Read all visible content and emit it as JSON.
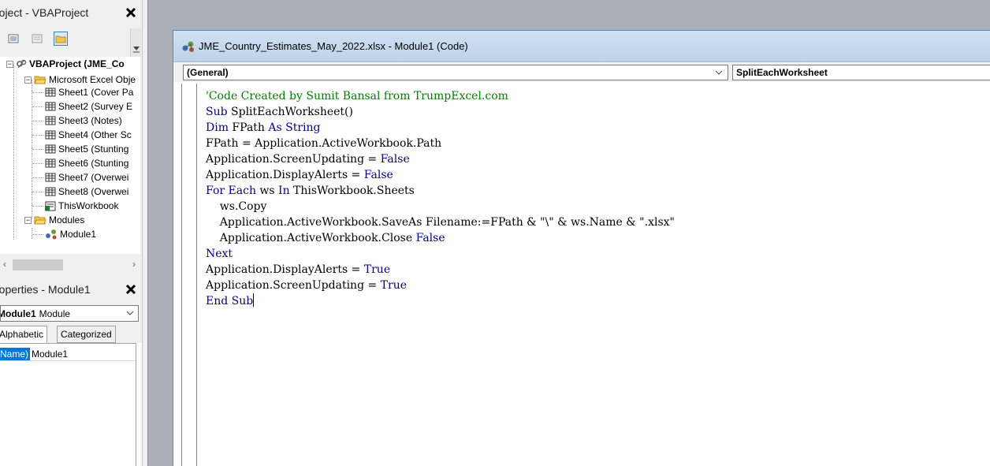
{
  "project_pane": {
    "title": "roject - VBAProject",
    "tree": {
      "root_label": "VBAProject (JME_Co",
      "folders": [
        {
          "label": "Microsoft Excel Obje",
          "items": [
            "Sheet1 (Cover Pa",
            "Sheet2 (Survey E",
            "Sheet3 (Notes)",
            "Sheet4 (Other Sc",
            "Sheet5 (Stunting",
            "Sheet6 (Stunting",
            "Sheet7 (Overwei",
            "Sheet8 (Overwei",
            "ThisWorkbook"
          ]
        },
        {
          "label": "Modules",
          "items": [
            "Module1"
          ]
        }
      ]
    }
  },
  "properties_pane": {
    "title": "roperties - Module1",
    "object_name": "Module1",
    "object_type": "Module",
    "tabs": [
      "Alphabetic",
      "Categorized"
    ],
    "rows": [
      {
        "name": "(Name)",
        "value": "Module1"
      }
    ]
  },
  "code_window": {
    "title": "JME_Country_Estimates_May_2022.xlsx - Module1 (Code)",
    "object_combo": "(General)",
    "procedure_combo": "SplitEachWorksheet",
    "code_lines": [
      "'Code Created by Sumit Bansal from TrumpExcel.com",
      "Sub SplitEachWorksheet()",
      "Dim FPath As String",
      "FPath = Application.ActiveWorkbook.Path",
      "Application.ScreenUpdating = False",
      "Application.DisplayAlerts = False",
      "For Each ws In ThisWorkbook.Sheets",
      "    ws.Copy",
      "    Application.ActiveWorkbook.SaveAs Filename:=FPath & \"\\\" & ws.Name & \".xlsx\"",
      "    Application.ActiveWorkbook.Close False",
      "Next",
      "Application.DisplayAlerts = True",
      "Application.ScreenUpdating = True",
      "End Sub"
    ]
  },
  "colors": {
    "keyword": "#00008b",
    "comment": "#008000",
    "selection": "#0078d7"
  }
}
